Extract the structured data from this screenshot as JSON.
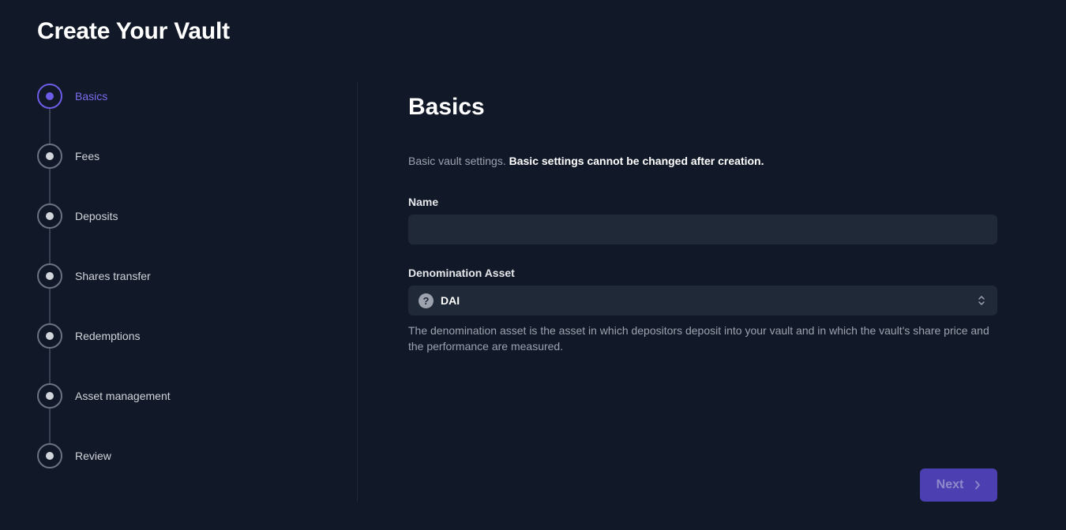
{
  "page": {
    "title": "Create Your Vault"
  },
  "stepper": {
    "steps": [
      {
        "label": "Basics",
        "active": true
      },
      {
        "label": "Fees",
        "active": false
      },
      {
        "label": "Deposits",
        "active": false
      },
      {
        "label": "Shares transfer",
        "active": false
      },
      {
        "label": "Redemptions",
        "active": false
      },
      {
        "label": "Asset management",
        "active": false
      },
      {
        "label": "Review",
        "active": false
      }
    ]
  },
  "form": {
    "title": "Basics",
    "description": "Basic vault settings.",
    "description_bold": "Basic settings cannot be changed after creation.",
    "name_label": "Name",
    "name_value": "",
    "asset_label": "Denomination Asset",
    "asset_icon": "question-mark-icon",
    "asset_value": "DAI",
    "asset_helper": "The denomination asset is the asset in which depositors deposit into your vault and in which the vault's share price and the performance are measured.",
    "next_label": "Next"
  },
  "colors": {
    "background": "#111827",
    "accent": "#6d5ce8",
    "input_bg": "#1f2937",
    "button_bg": "#4c3fb1"
  }
}
